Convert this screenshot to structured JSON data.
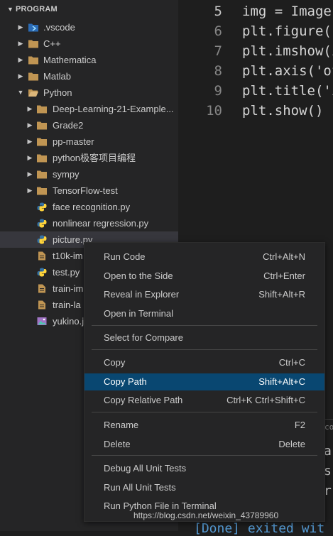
{
  "sidebar": {
    "header": "PROGRAM",
    "items": [
      {
        "label": ".vscode",
        "type": "folder-vscode",
        "depth": 0,
        "expanded": false
      },
      {
        "label": "C++",
        "type": "folder",
        "depth": 0,
        "expanded": false
      },
      {
        "label": "Mathematica",
        "type": "folder",
        "depth": 0,
        "expanded": false
      },
      {
        "label": "Matlab",
        "type": "folder",
        "depth": 0,
        "expanded": false
      },
      {
        "label": "Python",
        "type": "folder-open",
        "depth": 0,
        "expanded": true
      },
      {
        "label": "Deep-Learning-21-Example...",
        "type": "folder",
        "depth": 1,
        "expanded": false
      },
      {
        "label": "Grade2",
        "type": "folder",
        "depth": 1,
        "expanded": false
      },
      {
        "label": "pp-master",
        "type": "folder",
        "depth": 1,
        "expanded": false
      },
      {
        "label": "python极客项目编程",
        "type": "folder",
        "depth": 1,
        "expanded": false
      },
      {
        "label": "sympy",
        "type": "folder",
        "depth": 1,
        "expanded": false
      },
      {
        "label": "TensorFlow-test",
        "type": "folder",
        "depth": 1,
        "expanded": false
      },
      {
        "label": "face recognition.py",
        "type": "python",
        "depth": 1
      },
      {
        "label": "nonlinear regression.py",
        "type": "python",
        "depth": 1
      },
      {
        "label": "picture.py",
        "type": "python",
        "depth": 1,
        "selected": true
      },
      {
        "label": "t10k-im",
        "type": "file",
        "depth": 1
      },
      {
        "label": "test.py",
        "type": "python",
        "depth": 1
      },
      {
        "label": "train-im",
        "type": "file",
        "depth": 1
      },
      {
        "label": "train-la",
        "type": "file",
        "depth": 1
      },
      {
        "label": "yukino.j",
        "type": "image",
        "depth": 1
      }
    ]
  },
  "editor": {
    "lines": [
      {
        "num": "5",
        "code": "img = Image",
        "active": true
      },
      {
        "num": "6",
        "code": "plt.figure(",
        "active": false
      },
      {
        "num": "7",
        "code": "plt.imshow(i",
        "active": false
      },
      {
        "num": "8",
        "code": "plt.axis('of",
        "active": false
      },
      {
        "num": "9",
        "code": "plt.title('i",
        "active": false
      },
      {
        "num": "10",
        "code": "plt.show()",
        "active": false
      }
    ]
  },
  "panel": {
    "fragments": [
      "cor",
      "ar",
      "s",
      "r",
      "[Done] exited wit"
    ]
  },
  "context_menu": {
    "groups": [
      [
        {
          "label": "Run Code",
          "shortcut": "Ctrl+Alt+N"
        },
        {
          "label": "Open to the Side",
          "shortcut": "Ctrl+Enter"
        },
        {
          "label": "Reveal in Explorer",
          "shortcut": "Shift+Alt+R"
        },
        {
          "label": "Open in Terminal",
          "shortcut": ""
        }
      ],
      [
        {
          "label": "Select for Compare",
          "shortcut": ""
        }
      ],
      [
        {
          "label": "Copy",
          "shortcut": "Ctrl+C"
        },
        {
          "label": "Copy Path",
          "shortcut": "Shift+Alt+C",
          "highlighted": true
        },
        {
          "label": "Copy Relative Path",
          "shortcut": "Ctrl+K Ctrl+Shift+C"
        }
      ],
      [
        {
          "label": "Rename",
          "shortcut": "F2"
        },
        {
          "label": "Delete",
          "shortcut": "Delete"
        }
      ],
      [
        {
          "label": "Debug All Unit Tests",
          "shortcut": ""
        },
        {
          "label": "Run All Unit Tests",
          "shortcut": ""
        },
        {
          "label": "Run Python File in Terminal",
          "shortcut": ""
        }
      ]
    ]
  },
  "watermark": "https://blog.csdn.net/weixin_43789960",
  "colors": {
    "sidebar_bg": "#252526",
    "editor_bg": "#1e1e1e",
    "menu_highlight": "#094771",
    "folder": "#c09553",
    "python_blue": "#3572A5",
    "python_yellow": "#ffd43b"
  }
}
